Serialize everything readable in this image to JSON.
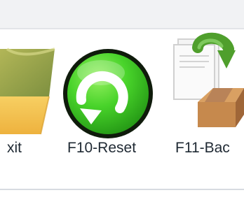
{
  "toolbar": {
    "items": [
      {
        "id": "exit",
        "label": "xit",
        "icon": "exit-icon"
      },
      {
        "id": "reset",
        "label": "F10-Reset",
        "icon": "reset-icon"
      },
      {
        "id": "backup",
        "label": "F11-Bac",
        "icon": "backup-icon"
      }
    ]
  },
  "colors": {
    "toolbar_background": "#ffffff",
    "top_strip": "#f1f2f4",
    "reset_green": "#39c91e",
    "backup_arrow_green": "#4f9f2c",
    "box_brown": "#c6894d",
    "exit_yellow": "#f3c04d",
    "exit_green": "#9aa54d"
  }
}
